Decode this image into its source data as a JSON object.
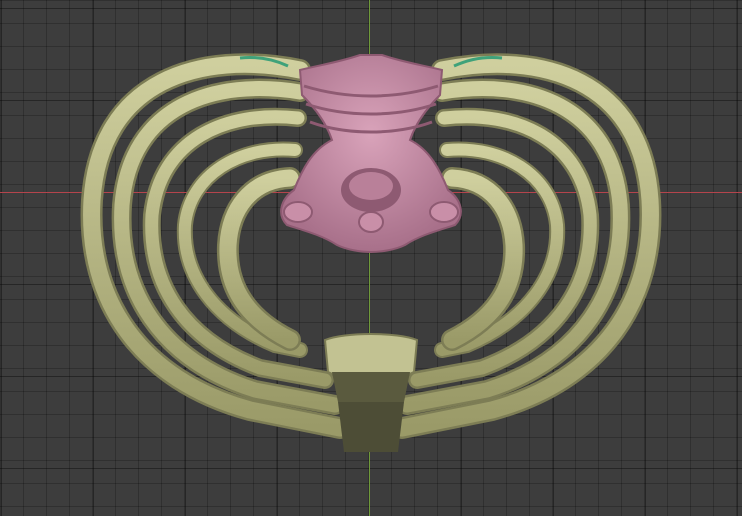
{
  "viewport": {
    "background": "#3d3d3d",
    "grid": true,
    "x_axis_color": "#b5444c",
    "y_axis_color": "#6f9a3a"
  },
  "model": {
    "object": "rib-cage-sculpt",
    "rib_color": "#b9b98a",
    "rib_shadow_color": "#7d7d55",
    "cartilage_color": "#5a5a3e",
    "vertebra_color": "#c98fa8",
    "vertebra_shadow_color": "#8e5a72",
    "edge_highlight_color": "#3fa27a"
  }
}
